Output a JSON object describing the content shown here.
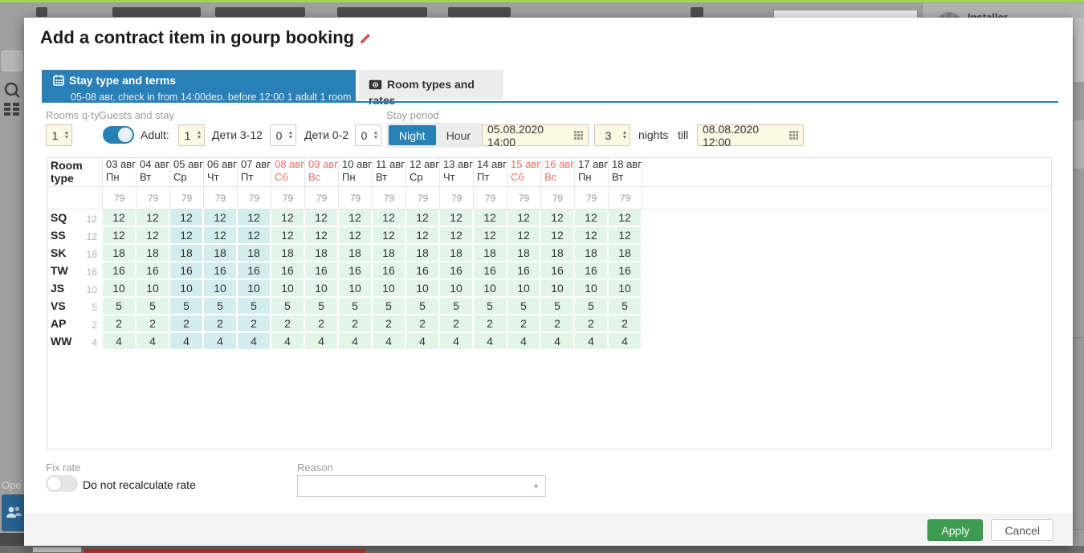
{
  "background": {
    "installer_label": "Installer",
    "open_label": "Ope"
  },
  "modal": {
    "title": "Add a contract item in gourp booking",
    "tabs": [
      {
        "label": "Stay type and terms",
        "subtitle": "05-08 авг, check in from 14:00dep. before 12:00 1 adult 1 room",
        "active": true
      },
      {
        "label": "Room types and rates",
        "active": false
      }
    ],
    "controls": {
      "rooms_qty_label": "Rooms q-ty",
      "rooms_qty": "1",
      "guests_label": "Guests and stay",
      "adult_label": "Adult:",
      "adult": "1",
      "children_3_12_label": "Дети 3-12",
      "children_3_12": "0",
      "children_0_2_label": "Дети 0-2",
      "children_0_2": "0",
      "stay_period_label": "Stay period",
      "night_label": "Night",
      "hour_label": "Hour",
      "check_in": "05.08.2020 14:00",
      "nights": "3",
      "nights_text": "nights",
      "till_text": "till",
      "check_out": "08.08.2020 12:00"
    },
    "table": {
      "room_type_header": "Room type",
      "capacity": "79",
      "columns": [
        {
          "date": "03 авг",
          "day": "Пн",
          "weekend": false,
          "highlight": false
        },
        {
          "date": "04 авг",
          "day": "Вт",
          "weekend": false,
          "highlight": false
        },
        {
          "date": "05 авг",
          "day": "Ср",
          "weekend": false,
          "highlight": true
        },
        {
          "date": "06 авг",
          "day": "Чт",
          "weekend": false,
          "highlight": true
        },
        {
          "date": "07 авг",
          "day": "Пт",
          "weekend": false,
          "highlight": true
        },
        {
          "date": "08 авг",
          "day": "Сб",
          "weekend": true,
          "highlight": false
        },
        {
          "date": "09 авг",
          "day": "Вс",
          "weekend": true,
          "highlight": false
        },
        {
          "date": "10 авг",
          "day": "Пн",
          "weekend": false,
          "highlight": false
        },
        {
          "date": "11 авг",
          "day": "Вт",
          "weekend": false,
          "highlight": false
        },
        {
          "date": "12 авг",
          "day": "Ср",
          "weekend": false,
          "highlight": false
        },
        {
          "date": "13 авг",
          "day": "Чт",
          "weekend": false,
          "highlight": false
        },
        {
          "date": "14 авг",
          "day": "Пт",
          "weekend": false,
          "highlight": false
        },
        {
          "date": "15 авг",
          "day": "Сб",
          "weekend": true,
          "highlight": false
        },
        {
          "date": "16 авг",
          "day": "Вс",
          "weekend": true,
          "highlight": false
        },
        {
          "date": "17 авг",
          "day": "Пн",
          "weekend": false,
          "highlight": false
        },
        {
          "date": "18 авг",
          "day": "Вт",
          "weekend": false,
          "highlight": false
        }
      ],
      "rows": [
        {
          "code": "SQ",
          "total": "12",
          "value": "12"
        },
        {
          "code": "SS",
          "total": "12",
          "value": "12"
        },
        {
          "code": "SK",
          "total": "18",
          "value": "18"
        },
        {
          "code": "TW",
          "total": "16",
          "value": "16"
        },
        {
          "code": "JS",
          "total": "10",
          "value": "10"
        },
        {
          "code": "VS",
          "total": "5",
          "value": "5"
        },
        {
          "code": "AP",
          "total": "2",
          "value": "2"
        },
        {
          "code": "WW",
          "total": "4",
          "value": "4"
        }
      ]
    },
    "fix_rate": {
      "label": "Fix rate",
      "toggle_label": "Do not recalculate rate"
    },
    "reason": {
      "label": "Reason"
    },
    "footer": {
      "apply": "Apply",
      "cancel": "Cancel"
    }
  }
}
